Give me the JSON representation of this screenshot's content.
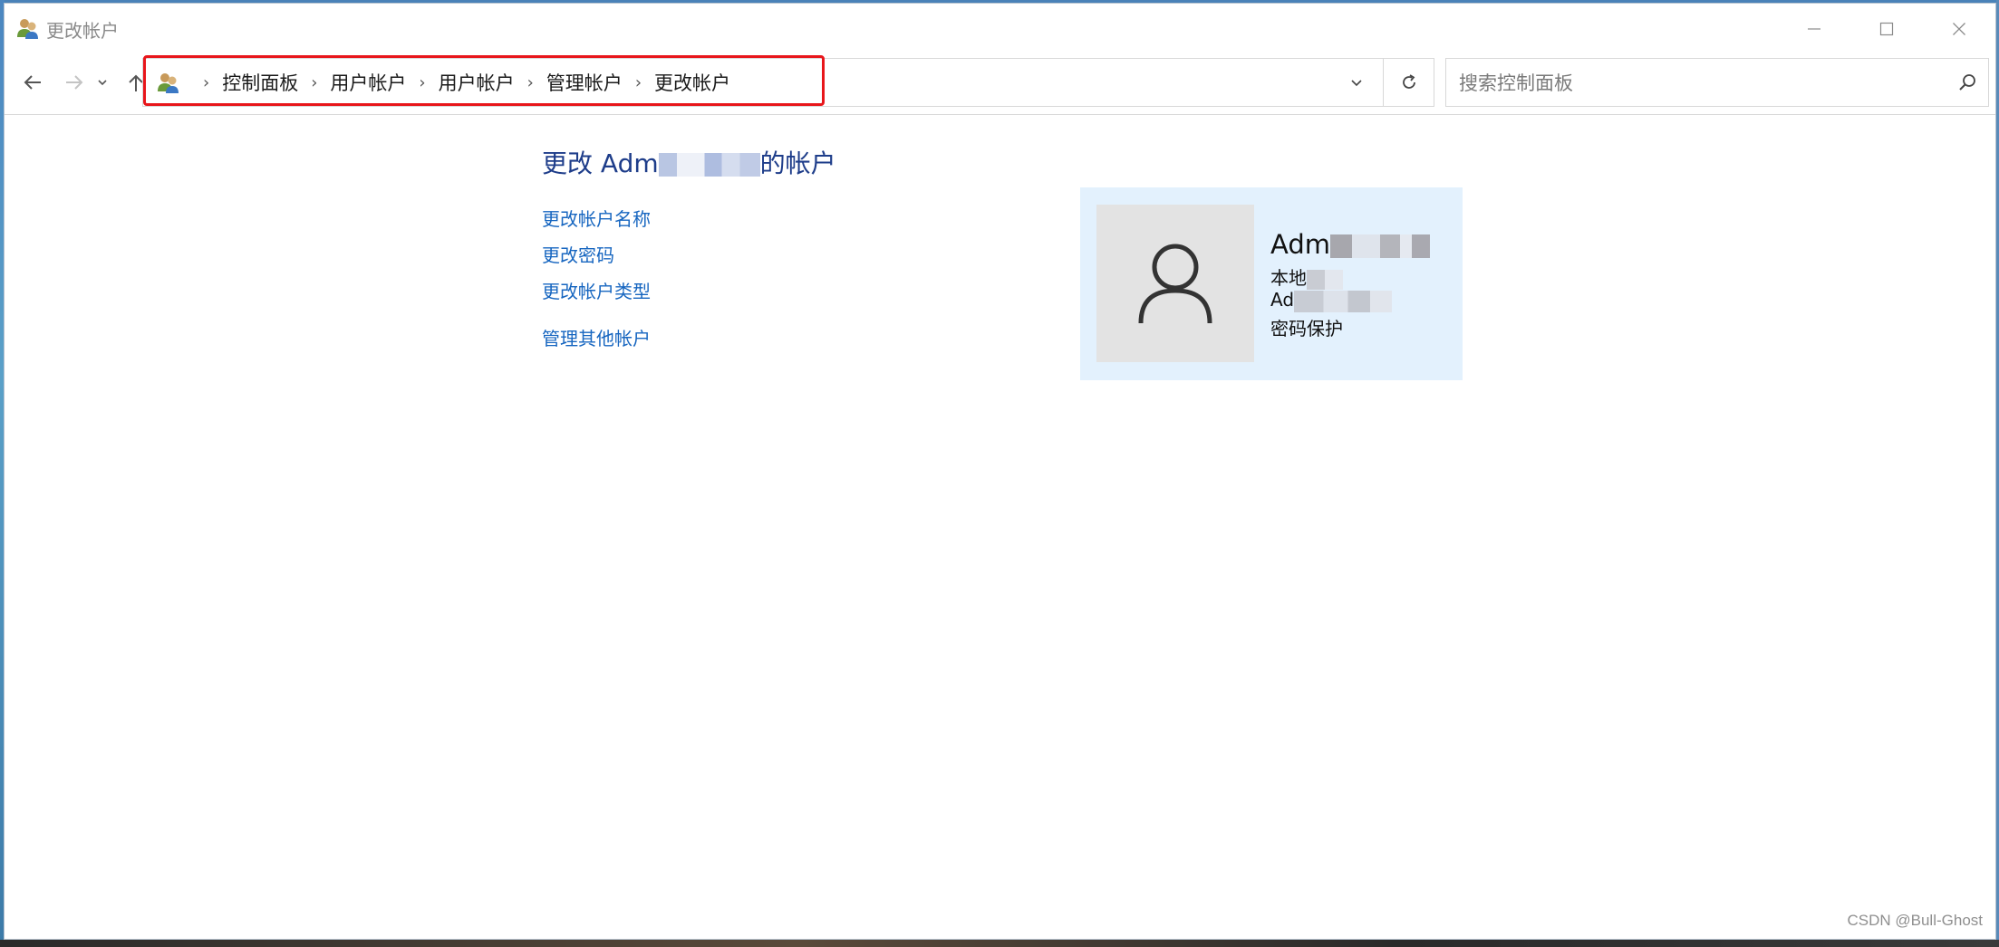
{
  "window": {
    "title": "更改帐户"
  },
  "address_bar": {
    "crumbs": [
      "控制面板",
      "用户帐户",
      "用户帐户",
      "管理帐户",
      "更改帐户"
    ]
  },
  "search": {
    "placeholder": "搜索控制面板"
  },
  "main": {
    "heading_prefix": "更改 Adm",
    "heading_suffix": "的帐户",
    "links": [
      "更改帐户名称",
      "更改密码",
      "更改帐户类型",
      "管理其他帐户"
    ]
  },
  "account_card": {
    "name_visible": "Adm",
    "line1_visible": "本地",
    "line2_visible": "Ad",
    "line3_visible": "密码保护"
  },
  "watermark": "CSDN @Bull-Ghost",
  "colors": {
    "heading": "#1e3d8a",
    "link": "#1766c0",
    "card_bg": "#e3f1fd",
    "highlight": "#e8161b"
  }
}
